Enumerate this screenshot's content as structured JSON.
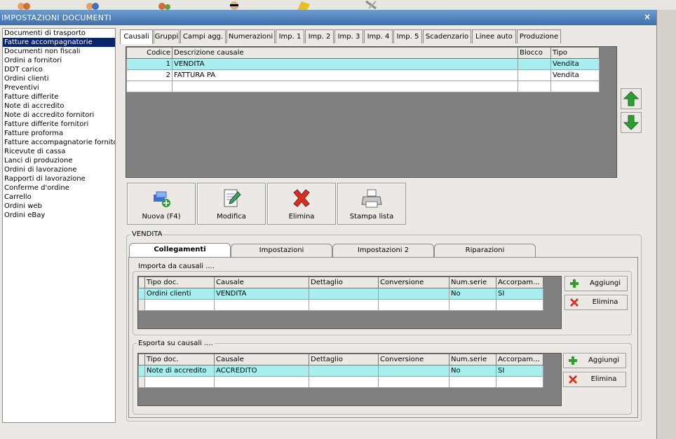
{
  "window": {
    "title": "IMPOSTAZIONI DOCUMENTI",
    "close": "×"
  },
  "sidebar": {
    "items": [
      "Documenti di trasporto",
      "Fatture accompagnatorie",
      "Documenti non fiscali",
      "Ordini a fornitori",
      "DDT carico",
      "Ordini clienti",
      "Preventivi",
      "Fatture differite",
      "Note di accredito",
      "Note di accredito fornitori",
      "Fatture differite fornitori",
      "Fatture proforma",
      "Fatture accompagnatorie fornito",
      "Ricevute di cassa",
      "Lanci di produzione",
      "Ordini di lavorazione",
      "Rapporti di lavorazione",
      "Conferme d'ordine",
      "Carrello",
      "Ordini web",
      "Ordini eBay"
    ],
    "selected": 1
  },
  "tabs": [
    "Causali",
    "Gruppi",
    "Campi agg.",
    "Numerazioni",
    "Imp. 1",
    "Imp. 2",
    "Imp. 3",
    "Imp. 4",
    "Imp. 5",
    "Scadenzario",
    "Linee auto",
    "Produzione"
  ],
  "causali": {
    "headers": [
      "Codice",
      "Descrizione causale",
      "Blocco",
      "Tipo"
    ],
    "rows": [
      [
        "1",
        "VENDITA",
        "",
        "Vendita"
      ],
      [
        "2",
        "FATTURA PA",
        "",
        "Vendita"
      ]
    ]
  },
  "actions": {
    "nuova": "Nuova (F4)",
    "modifica": "Modifica",
    "elimina": "Elimina",
    "stampa": "Stampa lista"
  },
  "detail": {
    "group_title": "VENDITA",
    "subtabs": [
      "Collegamenti",
      "Impostazioni",
      "Impostazioni 2",
      "Riparazioni"
    ],
    "importa": {
      "title": "Importa da causali ....",
      "headers": [
        "Tipo doc.",
        "Causale",
        "Dettaglio",
        "Conversione",
        "Num.serie",
        "Accorpam..."
      ],
      "rows": [
        [
          "Ordini clienti",
          "VENDITA",
          "",
          "",
          "No",
          "SI"
        ]
      ],
      "aggiungi": "Aggiungi",
      "elimina": "Elimina"
    },
    "esporta": {
      "title": "Esporta su causali ....",
      "headers": [
        "Tipo doc.",
        "Causale",
        "Dettaglio",
        "Conversione",
        "Num.serie",
        "Accorpam..."
      ],
      "rows": [
        [
          "Note di accredito",
          "ACCREDITO",
          "",
          "",
          "No",
          "SI"
        ]
      ],
      "aggiungi": "Aggiungi",
      "elimina": "Elimina"
    }
  },
  "colors": {
    "accent": "#0a246a",
    "row_highlight": "#a8eeee",
    "grid_bg": "#808080",
    "green": "#2e9e2e",
    "red": "#d83020"
  },
  "icons": {
    "up": "arrow-up-icon",
    "down": "arrow-down-icon",
    "new": "new-document-icon",
    "edit": "edit-icon",
    "delete": "delete-x-icon",
    "print": "printer-icon",
    "add": "plus-icon"
  }
}
